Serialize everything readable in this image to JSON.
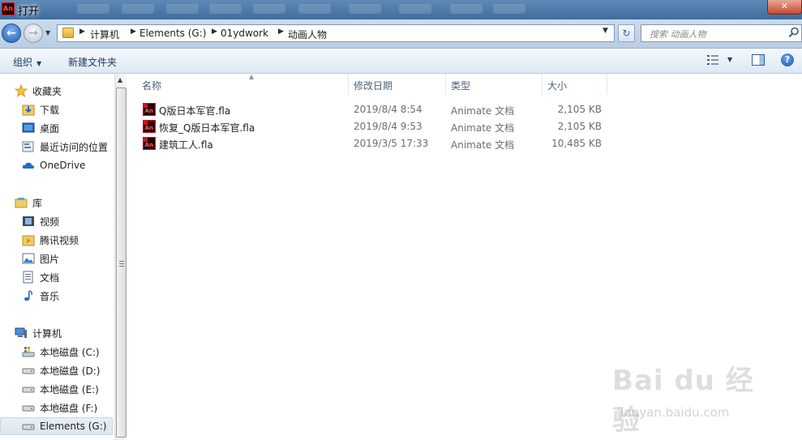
{
  "window": {
    "title": "打开",
    "app_icon_text": "An",
    "close_glyph": "✕"
  },
  "address": {
    "crumbs": [
      "计算机",
      "Elements (G:)",
      "01ydwork",
      "动画人物"
    ],
    "search_placeholder": "搜索 动画人物"
  },
  "toolbar": {
    "organize_label": "组织",
    "new_folder_label": "新建文件夹"
  },
  "nav": {
    "favorites": {
      "label": "收藏夹",
      "items": [
        "下载",
        "桌面",
        "最近访问的位置"
      ]
    },
    "onedrive": {
      "label": "OneDrive"
    },
    "libraries": {
      "label": "库",
      "items": [
        "视频",
        "腾讯视频",
        "图片",
        "文档",
        "音乐"
      ]
    },
    "computer": {
      "label": "计算机",
      "items": [
        "本地磁盘 (C:)",
        "本地磁盘 (D:)",
        "本地磁盘 (E:)",
        "本地磁盘 (F:)",
        "Elements (G:)"
      ],
      "selected_index": 4
    }
  },
  "columns": {
    "name": "名称",
    "modified": "修改日期",
    "type": "类型",
    "size": "大小"
  },
  "files": [
    {
      "name": "Q版日本军官.fla",
      "modified": "2019/8/4 8:54",
      "type": "Animate 文档",
      "size": "2,105 KB"
    },
    {
      "name": "恢复_Q版日本军官.fla",
      "modified": "2019/8/4 9:53",
      "type": "Animate 文档",
      "size": "2,105 KB"
    },
    {
      "name": "建筑工人.fla",
      "modified": "2019/3/5 17:33",
      "type": "Animate 文档",
      "size": "10,485 KB"
    }
  ],
  "watermark": {
    "brand": "Bai du 经验",
    "site": "jingyan.baidu.com"
  },
  "icons": {
    "back": "arrow-left-icon",
    "forward": "arrow-right-icon",
    "refresh": "refresh-icon",
    "search": "search-icon",
    "help": "help-icon",
    "file": "animate-fla-icon"
  }
}
